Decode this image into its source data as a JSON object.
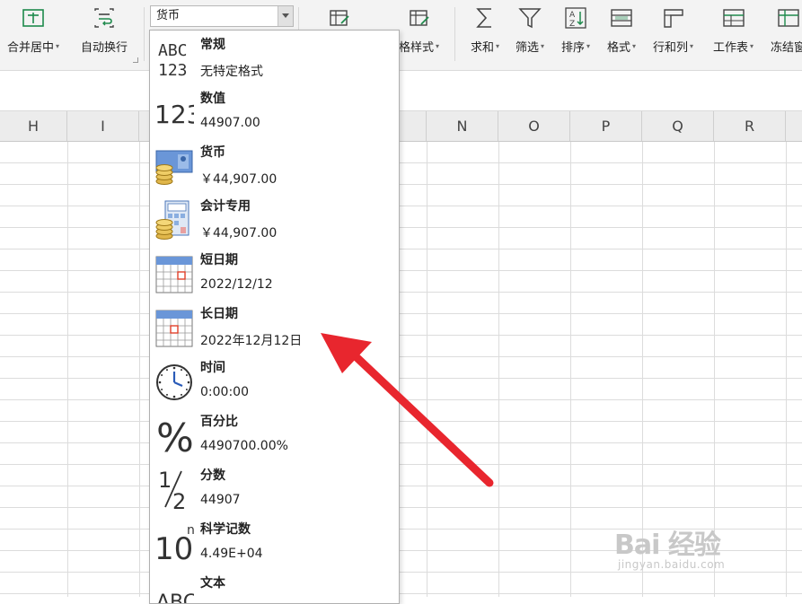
{
  "ribbon": {
    "merge_center": "合并居中",
    "wrap_text": "自动换行",
    "number_format_value": "货币",
    "cell_style_partial": "格样式",
    "sum": "求和",
    "filter": "筛选",
    "sort": "排序",
    "format": "格式",
    "rows_cols": "行和列",
    "worksheet": "工作表",
    "freeze_partial": "冻结窗"
  },
  "columns": [
    "H",
    "I",
    "N",
    "O",
    "P",
    "Q",
    "R"
  ],
  "format_menu": {
    "items": [
      {
        "name": "常规",
        "example": "无特定格式",
        "icon": "general-abc-icon"
      },
      {
        "name": "数值",
        "example": "44907.00",
        "icon": "number-123-icon"
      },
      {
        "name": "货币",
        "example": "￥44,907.00",
        "icon": "currency-coins-icon"
      },
      {
        "name": "会计专用",
        "example": " ￥44,907.00",
        "icon": "accounting-calculator-icon"
      },
      {
        "name": "短日期",
        "example": "2022/12/12",
        "icon": "short-date-calendar-icon"
      },
      {
        "name": "长日期",
        "example": "2022年12月12日",
        "icon": "long-date-calendar-icon"
      },
      {
        "name": "时间",
        "example": "0:00:00",
        "icon": "clock-icon"
      },
      {
        "name": "百分比",
        "example": "4490700.00%",
        "icon": "percent-icon"
      },
      {
        "name": "分数",
        "example": "44907",
        "icon": "fraction-icon"
      },
      {
        "name": "科学记数",
        "example": "4.49E+04",
        "icon": "scientific-notation-icon"
      },
      {
        "name": "文本",
        "example": "",
        "icon": "text-abc-icon"
      }
    ]
  },
  "icon_text": {
    "abc": "ABC",
    "n123": "123",
    "percent": "%",
    "frac_num": "1",
    "frac_den": "2",
    "ten": "10",
    "sup_n": "n"
  },
  "colors": {
    "arrow": "#e8262e",
    "ribbon_bg": "#f3f3f3",
    "header_bg": "#ececec",
    "accent_green": "#1e8a4c"
  },
  "watermark": {
    "title": "Bai 经验",
    "domain": "jingyan.baidu.com"
  }
}
